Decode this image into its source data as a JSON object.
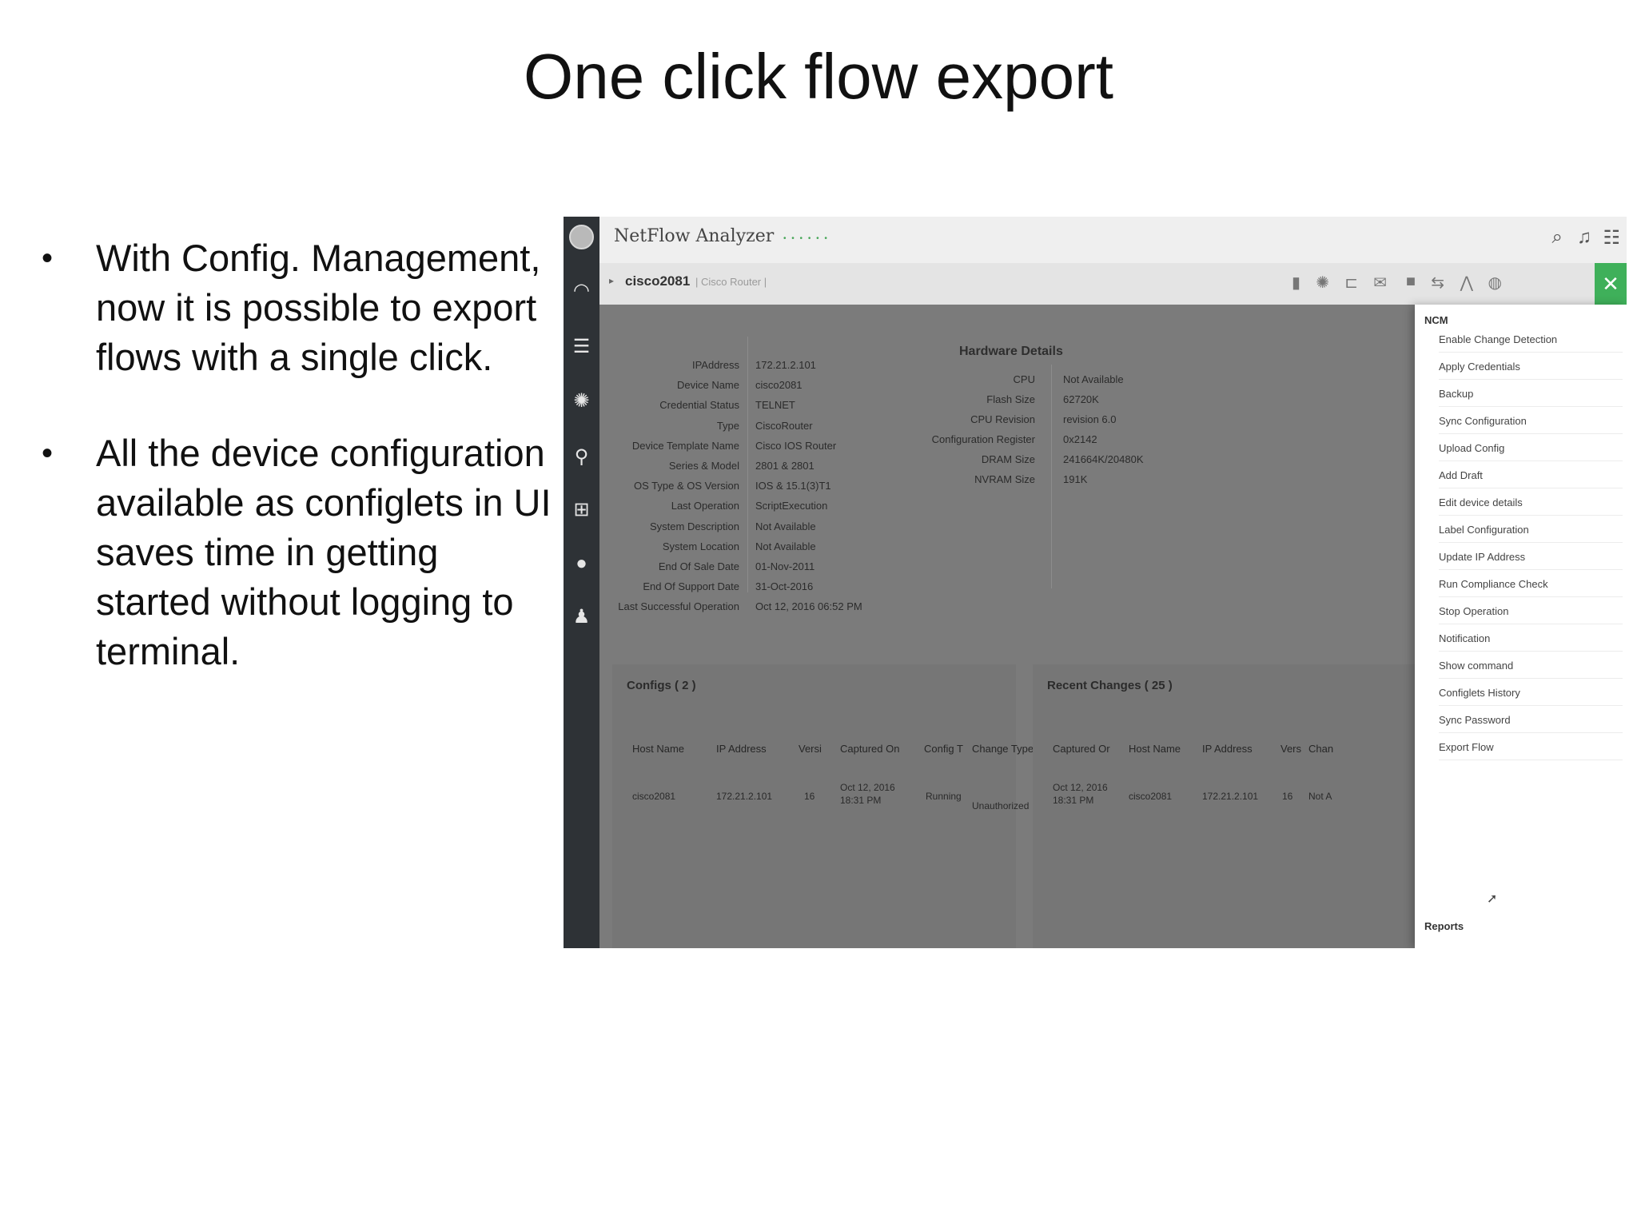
{
  "slide": {
    "title": "One click flow export",
    "bullets": [
      "With Config. Management, now it is possible to export flows with a single click.",
      "All the device configuration available as configlets in UI saves time in getting started without logging to terminal."
    ]
  },
  "app": {
    "title": "NetFlow Analyzer",
    "brand_dots": "• • • • • •",
    "accent_color": "#3fb05a"
  },
  "device": {
    "name": "cisco2081",
    "type": "| Cisco Router |"
  },
  "device_info": [
    {
      "label": "IPAddress",
      "value": "172.21.2.101"
    },
    {
      "label": "Device Name",
      "value": "cisco2081"
    },
    {
      "label": "Credential Status",
      "value": "TELNET"
    },
    {
      "label": "Type",
      "value": "CiscoRouter"
    },
    {
      "label": "Device Template Name",
      "value": "Cisco IOS Router"
    },
    {
      "label": "Series & Model",
      "value": "2801 & 2801"
    },
    {
      "label": "OS Type & OS Version",
      "value": "IOS & 15.1(3)T1"
    },
    {
      "label": "Last Operation",
      "value": "ScriptExecution"
    },
    {
      "label": "System Description",
      "value": "Not Available"
    },
    {
      "label": "System Location",
      "value": "Not Available"
    },
    {
      "label": "End Of Sale Date",
      "value": "01-Nov-2011"
    },
    {
      "label": "End Of Support Date",
      "value": "31-Oct-2016"
    },
    {
      "label": "Last Successful Operation",
      "value": "Oct 12, 2016 06:52 PM"
    }
  ],
  "hardware": {
    "title": "Hardware Details",
    "rows": [
      {
        "label": "CPU",
        "value": "Not Available"
      },
      {
        "label": "Flash Size",
        "value": "62720K"
      },
      {
        "label": "CPU Revision",
        "value": "revision 6.0"
      },
      {
        "label": "Configuration Register",
        "value": "0x2142"
      },
      {
        "label": "DRAM Size",
        "value": "241664K/20480K"
      },
      {
        "label": "NVRAM Size",
        "value": "191K"
      }
    ]
  },
  "configs": {
    "title": "Configs ( 2 )",
    "headers": [
      "Host Name",
      "IP Address",
      "Versi",
      "Captured On",
      "Config T",
      "Change Type"
    ],
    "row": [
      "cisco2081",
      "172.21.2.101",
      "16",
      "Oct 12, 2016 18:31 PM",
      "Running",
      "Unauthorized"
    ]
  },
  "recent_changes": {
    "title": "Recent Changes ( 25 )",
    "headers": [
      "Captured Or",
      "Host Name",
      "IP Address",
      "Vers",
      "Chan"
    ],
    "row": [
      "Oct 12, 2016 18:31 PM",
      "cisco2081",
      "172.21.2.101",
      "16",
      "Not A"
    ]
  },
  "menu": {
    "header": "NCM",
    "items": [
      "Enable Change Detection",
      "Apply Credentials",
      "Backup",
      "Sync Configuration",
      "Upload Config",
      "Add Draft",
      "Edit device details",
      "Label Configuration",
      "Update IP Address",
      "Run Compliance Check",
      "Stop Operation",
      "Notification",
      "Show command",
      "Configlets History",
      "Sync Password",
      "Export Flow"
    ],
    "footer": "Reports"
  }
}
